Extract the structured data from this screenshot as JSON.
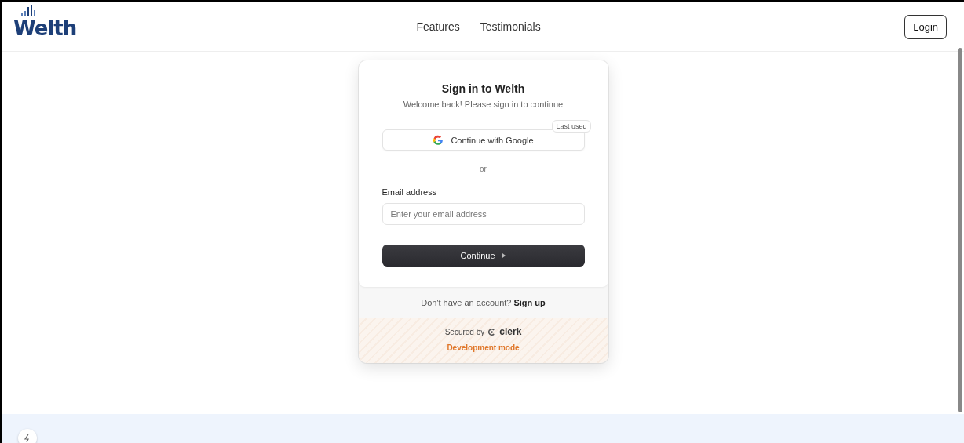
{
  "header": {
    "logo": "Welth",
    "nav": [
      "Features",
      "Testimonials"
    ],
    "login": "Login"
  },
  "card": {
    "title": "Sign in to Welth",
    "subtitle": "Welcome back! Please sign in to continue",
    "google": {
      "label": "Continue with Google",
      "badge": "Last used"
    },
    "divider": "or",
    "email": {
      "label": "Email address",
      "placeholder": "Enter your email address"
    },
    "continue": "Continue",
    "signup": {
      "prompt": "Don't have an account?",
      "link": "Sign up"
    },
    "secured": {
      "text": "Secured by",
      "brand": "clerk"
    },
    "dev_mode": "Development mode"
  }
}
